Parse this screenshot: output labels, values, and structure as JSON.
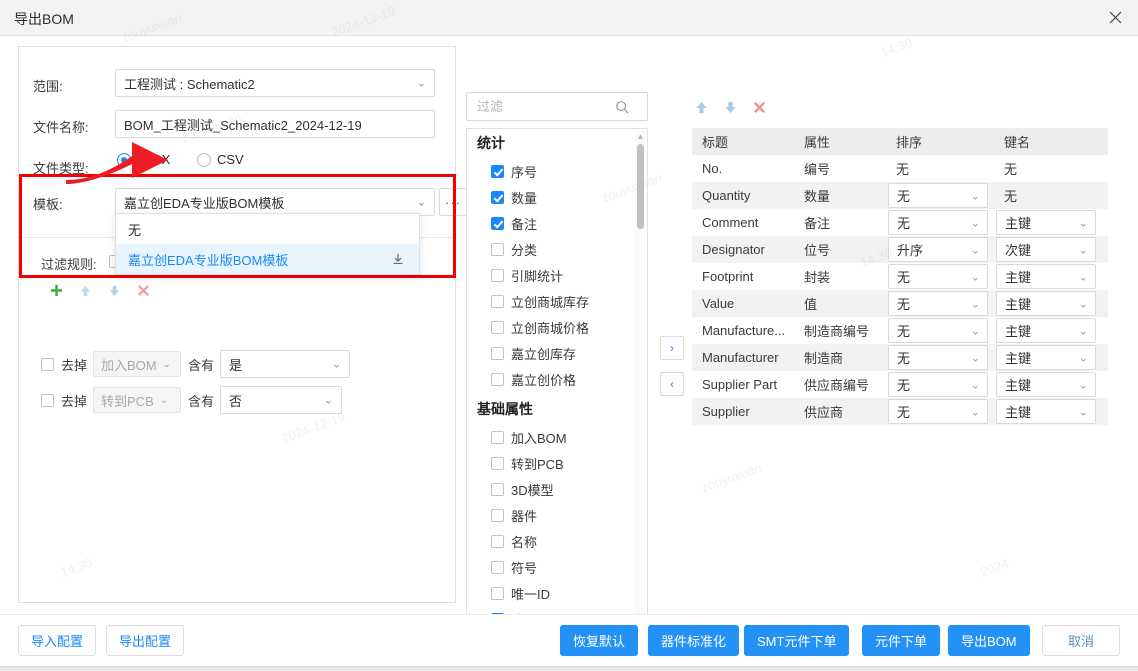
{
  "window": {
    "title": "导出BOM",
    "close_icon": "close-icon"
  },
  "left_panel": {
    "scope_label": "范围:",
    "scope_value": "工程测试 : Schematic2",
    "filename_label": "文件名称:",
    "filename_value": "BOM_工程测试_Schematic2_2024-12-19",
    "filetype_label": "文件类型:",
    "filetype_options": [
      {
        "label": "XLSX",
        "selected": true
      },
      {
        "label": "CSV",
        "selected": false
      }
    ],
    "template_label": "模板:",
    "template_value": "嘉立创EDA专业版BOM模板",
    "template_more_label": "···",
    "template_dropdown": [
      {
        "label": "无",
        "active": false,
        "has_download": false
      },
      {
        "label": "嘉立创EDA专业版BOM模板",
        "active": true,
        "has_download": true
      }
    ],
    "filter_rules_label": "过滤规则:",
    "rule_toolbar_icons": [
      "add-icon",
      "move-up-icon",
      "move-down-icon",
      "delete-icon"
    ],
    "rules": [
      {
        "checked": false,
        "negate_label": "去掉",
        "field_label": "加入BOM",
        "operator_label": "含有",
        "value_label": "是"
      },
      {
        "checked": false,
        "negate_label": "去掉",
        "field_label": "转到PCB",
        "operator_label": "含有",
        "value_label": "否"
      }
    ]
  },
  "middle_panel": {
    "search_placeholder": "过滤",
    "search_value": "",
    "search_icon": "search-icon",
    "groups": [
      {
        "title": "统计",
        "items": [
          {
            "label": "序号",
            "checked": true
          },
          {
            "label": "数量",
            "checked": true
          },
          {
            "label": "备注",
            "checked": true
          },
          {
            "label": "分类",
            "checked": false
          },
          {
            "label": "引脚统计",
            "checked": false
          },
          {
            "label": "立创商城库存",
            "checked": false
          },
          {
            "label": "立创商城价格",
            "checked": false
          },
          {
            "label": "嘉立创库存",
            "checked": false
          },
          {
            "label": "嘉立创价格",
            "checked": false
          }
        ]
      },
      {
        "title": "基础属性",
        "items": [
          {
            "label": "加入BOM",
            "checked": false
          },
          {
            "label": "转到PCB",
            "checked": false
          },
          {
            "label": "3D模型",
            "checked": false
          },
          {
            "label": "器件",
            "checked": false
          },
          {
            "label": "名称",
            "checked": false
          },
          {
            "label": "符号",
            "checked": false
          },
          {
            "label": "唯一ID",
            "checked": false
          },
          {
            "label": "位号",
            "checked": true
          }
        ]
      }
    ]
  },
  "transfer": {
    "to_right_label": "›",
    "to_left_label": "‹"
  },
  "right_panel": {
    "toolbar_icons": [
      "move-up-icon",
      "move-down-icon",
      "delete-icon"
    ],
    "columns": [
      "标题",
      "属性",
      "排序",
      "键名"
    ],
    "rows": [
      {
        "title": "No.",
        "attribute": "编号",
        "sort": "无",
        "sort_select": false,
        "key": "无",
        "key_select": false
      },
      {
        "title": "Quantity",
        "attribute": "数量",
        "sort": "无",
        "sort_select": true,
        "key": "无",
        "key_select": false
      },
      {
        "title": "Comment",
        "attribute": "备注",
        "sort": "无",
        "sort_select": true,
        "key": "主键",
        "key_select": true
      },
      {
        "title": "Designator",
        "attribute": "位号",
        "sort": "升序",
        "sort_select": true,
        "key": "次键",
        "key_select": true
      },
      {
        "title": "Footprint",
        "attribute": "封装",
        "sort": "无",
        "sort_select": true,
        "key": "主键",
        "key_select": true
      },
      {
        "title": "Value",
        "attribute": "值",
        "sort": "无",
        "sort_select": true,
        "key": "主键",
        "key_select": true
      },
      {
        "title": "Manufacture...",
        "attribute": "制造商编号",
        "sort": "无",
        "sort_select": true,
        "key": "主键",
        "key_select": true
      },
      {
        "title": "Manufacturer",
        "attribute": "制造商",
        "sort": "无",
        "sort_select": true,
        "key": "主键",
        "key_select": true
      },
      {
        "title": "Supplier Part",
        "attribute": "供应商编号",
        "sort": "无",
        "sort_select": true,
        "key": "主键",
        "key_select": true
      },
      {
        "title": "Supplier",
        "attribute": "供应商",
        "sort": "无",
        "sort_select": true,
        "key": "主键",
        "key_select": true
      }
    ]
  },
  "footer": {
    "import_config": "导入配置",
    "export_config": "导出配置",
    "restore_default": "恢复默认",
    "standardize": "器件标准化",
    "smt_order": "SMT元件下单",
    "part_order": "元件下单",
    "export_bom": "导出BOM",
    "cancel": "取消"
  },
  "colors": {
    "accent": "#1989fa",
    "primary_button": "#2391f5",
    "highlight_rect": "#f40000",
    "arrow": "#ee1c25"
  },
  "annotations": {
    "arrow_icon": "red-arrow-pointing-to-xlsx-radio",
    "highlight_icon": "red-rectangle-around-template-row"
  }
}
